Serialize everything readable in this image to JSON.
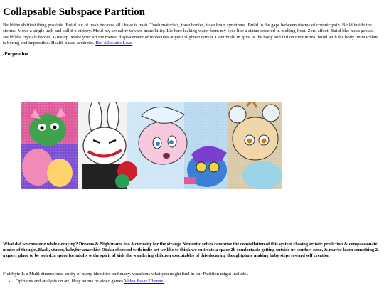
{
  "page": {
    "title": "Collapsable Subspace Partition",
    "intro_text": "Build the shittiest thing possible. Build out of trash because all i have is trash. Trash materials, trash bodies, trash brain syndrome. Build in the gaps between storms of chronic pain. Build inside the storms. Move a single inch and call it a victory. Mold my sexuality toward immobility. Lie here leaking water from my eyes like a statue covered in melting frost. Zero affect. Build like moss grows. Build like crystals harden. Give up. Make your art the merest displacement of molecules at your slightest quiver. Dont build in spite of the body and fail on their terms, build with the body. Immaculate is boring and impossible. Health based aesthetic.",
    "intro_link": "Hot Allostatic Load",
    "signature": "-Porpentine",
    "description": "What did we consume while decaying? Dreams & Nightmares too A curiosity for the strange Neotentic selves comprise the constellation of this system chasing artistic profiction & compassionate modes of thought,Black, vtuber, babyfur anarchist Otaku obsessed with indie art we like to think we cultivate a space 2b comfortable getting outside ur comfort zone, & maybe learn something 2. a queer place to be weird. a space for adults w the spirit of kids the wandering children executables of this decaying thoughtplane making baby steps toward self creation",
    "intro_paragraph": "Fluffbyte Is a Multi dimensional entity of many identities and many. vocations what you might find in our Partition might include..",
    "list": [
      {
        "text": "Opinions and analysis on art, likey anime or video games",
        "link": "Video Essay Channel"
      }
    ]
  },
  "colors": {
    "link": "#0000ee",
    "text": "#000000",
    "background": "#ffffff"
  }
}
